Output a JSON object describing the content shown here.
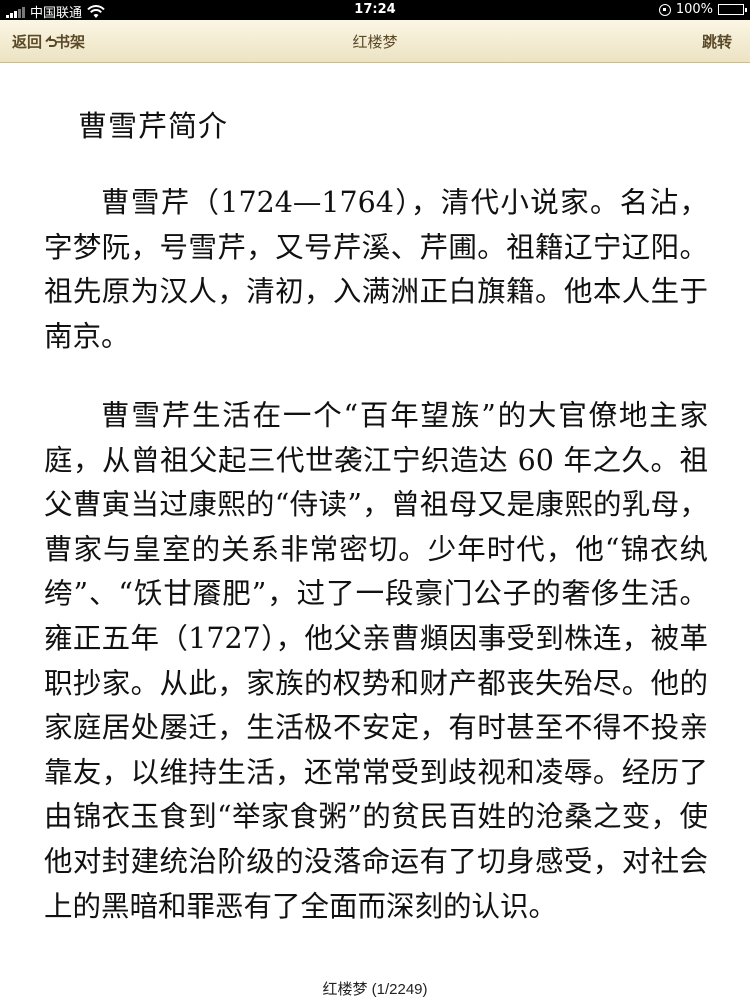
{
  "statusbar": {
    "carrier": "中国联通",
    "time": "17:24",
    "battery": "100%"
  },
  "toolbar": {
    "back_label": "返回",
    "shelf_label": "书架",
    "title": "红楼梦",
    "jump_label": "跳转"
  },
  "article": {
    "heading": "曹雪芹简介",
    "paragraphs": [
      "曹雪芹（1724—1764），清代小说家。名沾，字梦阮，号雪芹，又号芹溪、芹圃。祖籍辽宁辽阳。祖先原为汉人，清初，入满洲正白旗籍。他本人生于南京。",
      "曹雪芹生活在一个“百年望族”的大官僚地主家庭，从曾祖父起三代世袭江宁织造达 60 年之久。祖父曹寅当过康熙的“侍读”，曾祖母又是康熙的乳母，曹家与皇室的关系非常密切。少年时代，他“锦衣纨绔”、“饫甘餍肥”，过了一段豪门公子的奢侈生活。雍正五年（1727），他父亲曹頫因事受到株连，被革职抄家。从此，家族的权势和财产都丧失殆尽。他的家庭居处屡迁，生活极不安定，有时甚至不得不投亲靠友，以维持生活，还常常受到歧视和凌辱。经历了由锦衣玉食到“举家食粥”的贫民百姓的沧桑之变，使他对封建统治阶级的没落命运有了切身感受，对社会上的黑暗和罪恶有了全面而深刻的认识。"
    ]
  },
  "footer": {
    "page_indicator": "红楼梦 (1/2249)"
  },
  "icons": {
    "signal": "signal-bars-icon",
    "wifi": "wifi-icon",
    "rotation_lock": "rotation-lock-icon",
    "battery": "battery-icon",
    "back": "back-arrow-icon"
  },
  "colors": {
    "toolbar_bg": "#f4edd3",
    "toolbar_text": "#5a4a28",
    "page_bg": "#ffffff",
    "text": "#111111"
  }
}
